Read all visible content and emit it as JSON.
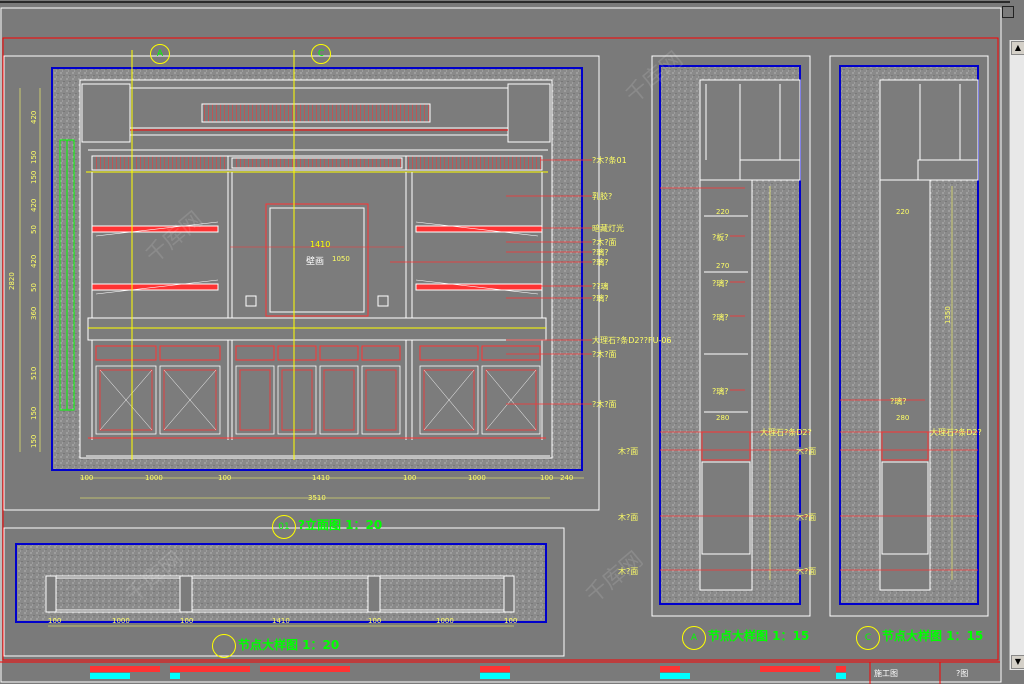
{
  "elevation": {
    "title": "?立面图 1：20",
    "number": "01",
    "grid_a": "A",
    "grid_c": "C",
    "center_label": "壁画",
    "center_width": "1410",
    "center_height": "1050",
    "dims_bottom": [
      "100",
      "1000",
      "100",
      "1410",
      "100",
      "1000",
      "100",
      "240"
    ],
    "total_width": "3510",
    "dims_left": [
      "420",
      "150",
      "150",
      "420",
      "50",
      "420",
      "50",
      "360",
      "510",
      "150",
      "150"
    ],
    "total_height": "2820",
    "callouts": [
      "?木?条01",
      "乳胶?",
      "暗藏灯光",
      "?木?面",
      "?璃?",
      "?璃?",
      "??璃",
      "?璃?",
      "大理石?条D2??FU-06",
      "?木?面",
      "?木?面"
    ]
  },
  "section_a": {
    "title": "节点大样图 1：15",
    "marker": "A",
    "dims": [
      "220",
      "270",
      "280"
    ],
    "callouts_right": [
      "?板?",
      "?璃?",
      "?璃?",
      "?璃?",
      "大理石?条D2?",
      "木?面",
      "木?面",
      "木?面"
    ]
  },
  "section_c": {
    "title": "节点大样图 1：15",
    "marker": "C",
    "dims": [
      "220",
      "280"
    ],
    "callouts": [
      "?璃?",
      "大理石?条D2?",
      "木?面",
      "木?面",
      "木?面"
    ],
    "height_dim": "1350"
  },
  "plan": {
    "title": "节点大样图 1：20",
    "dims": [
      "100",
      "1000",
      "100",
      "1410",
      "100",
      "1000",
      "100"
    ]
  },
  "watermark": "千库网",
  "titleblock": {
    "stamp": "施工图",
    "sheet": "?图"
  }
}
